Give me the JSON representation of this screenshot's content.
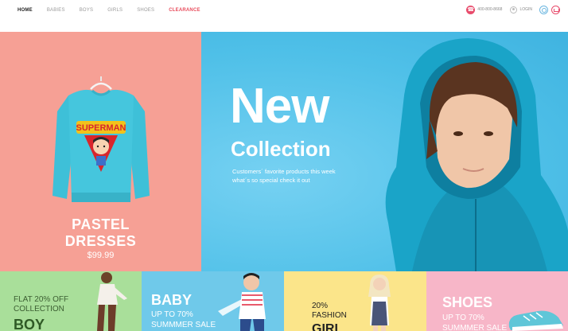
{
  "nav": {
    "items": [
      "HOME",
      "BABIES",
      "BOYS",
      "GIRLS",
      "SHOES",
      "CLEARANCE"
    ]
  },
  "header": {
    "phone": "400-800-8668",
    "login": "LOGIN"
  },
  "hero_left": {
    "title_line1": "PASTEL",
    "title_line2": "DRESSES",
    "price": "$99.99",
    "shirt_print": "SUPERMAN"
  },
  "hero_right": {
    "title": "New",
    "subtitle": "Collection",
    "tagline_line1": "Customers´ favorite products this week",
    "tagline_line2": "what´s so special check it out"
  },
  "categories": [
    {
      "small1": "FLAT 20% OFF",
      "small2": "COLLECTION",
      "big": "BOY"
    },
    {
      "big": "BABY",
      "small1": "UP TO 70%",
      "small2": "SUMMMER SALE"
    },
    {
      "small1": "20%",
      "small2": "FASHION",
      "big": "GIRL"
    },
    {
      "big": "SHOES",
      "small1": "UP TO 70%",
      "small2": "SUMMMER SALE"
    }
  ],
  "colors": {
    "hero_left_bg": "#f6a095",
    "hero_right_bg": "#4fc0e8",
    "cat_boy": "#a9df9a",
    "cat_baby": "#6fc9ea",
    "cat_girl": "#fbe58a",
    "cat_shoes": "#f7b6c8",
    "accent": "#e84c6c"
  }
}
